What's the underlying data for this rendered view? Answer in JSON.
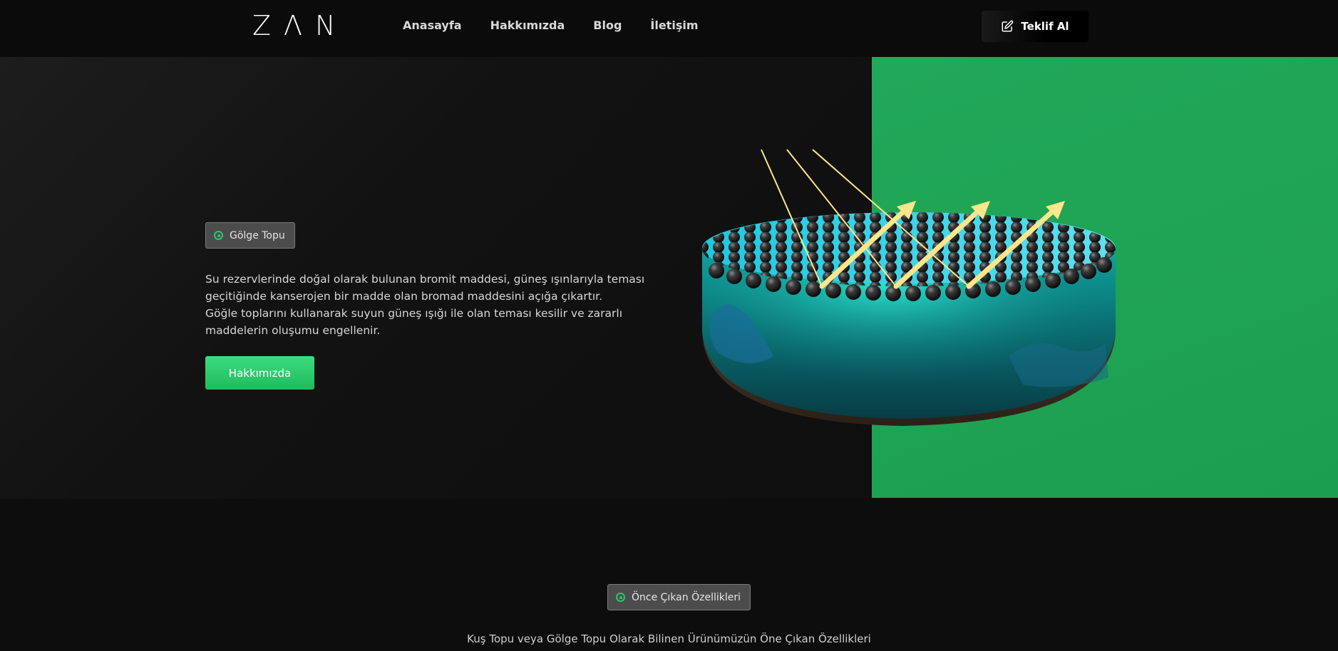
{
  "header": {
    "logo_letters": [
      "Z",
      "Λ",
      "N"
    ],
    "nav": [
      "Anasayfa",
      "Hakkımızda",
      "Blog",
      "İletişim"
    ],
    "cta_label": "Teklif Al",
    "cta_icon": "edit-icon"
  },
  "hero": {
    "tag_label": "Gölge Topu",
    "paragraph_1": "Su rezervlerinde doğal olarak bulunan bromit maddesi, güneş ışınlarıyla teması geçitiğinde kanserojen bir madde olan bromad maddesini açığa çıkartır.",
    "paragraph_2": "Göğle toplarını kullanarak suyun güneş ışığı ile olan teması kesilir ve zararlı maddelerin oluşumu engellenir.",
    "button_label": "Hakkımızda",
    "colors": {
      "accent_green": "#2cc66a",
      "panel_green": "#1fa354",
      "ray_yellow": "#fde68a"
    }
  },
  "features": {
    "tag_label": "Önce Çıkan Özellikleri",
    "subtitle": "Kuş Topu veya Gölge Topu Olarak Bilinen Ürünümüzün Öne Çıkan Özellikleri"
  }
}
